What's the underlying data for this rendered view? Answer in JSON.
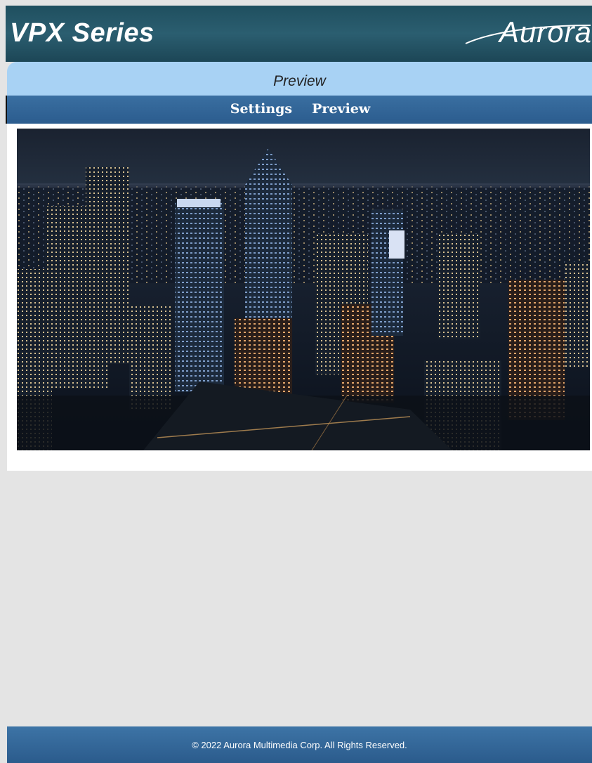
{
  "header": {
    "title": "VPX Series",
    "logo_text": "Aurora"
  },
  "title_bar": {
    "title": "Preview"
  },
  "nav": {
    "items": [
      {
        "label": "Settings"
      },
      {
        "label": "Preview"
      }
    ]
  },
  "preview": {
    "icon": "video-preview-image"
  },
  "footer": {
    "copyright": "© 2022 Aurora Multimedia Corp. All Rights Reserved."
  },
  "colors": {
    "header_bg": "#2b5e70",
    "title_bar_bg": "#a8d2f4",
    "nav_bg": "#2b5c8e",
    "page_bg": "#e4e4e4",
    "footer_bg": "#3d74a6"
  }
}
